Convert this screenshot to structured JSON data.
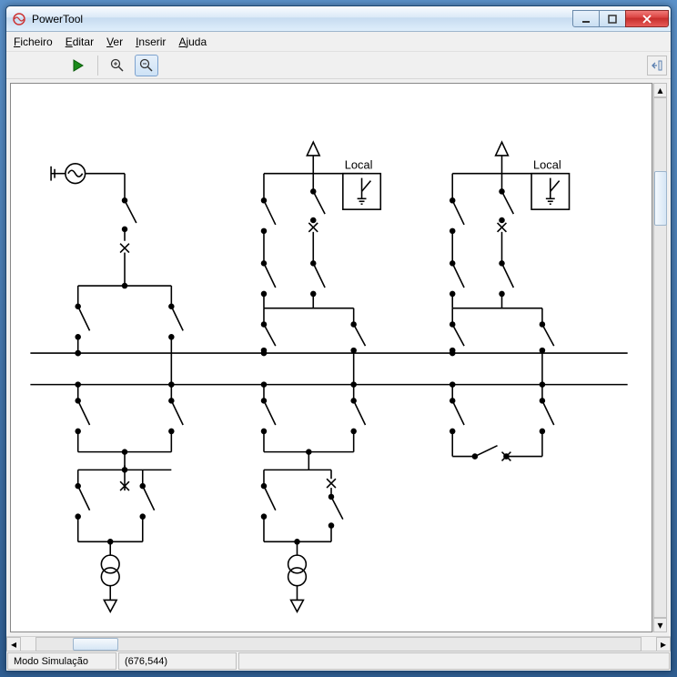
{
  "window": {
    "title": "PowerTool"
  },
  "menubar": {
    "items": [
      {
        "label": "Ficheiro",
        "underline_index": 0
      },
      {
        "label": "Editar",
        "underline_index": 0
      },
      {
        "label": "Ver",
        "underline_index": 0
      },
      {
        "label": "Inserir",
        "underline_index": 0
      },
      {
        "label": "Ajuda",
        "underline_index": 0
      }
    ]
  },
  "toolbar": {
    "run": "Run",
    "zoom_in": "Zoom In",
    "zoom_out": "Zoom Out"
  },
  "canvas": {
    "local_label_1": "Local",
    "local_label_2": "Local"
  },
  "statusbar": {
    "mode": "Modo Simulação",
    "coords": "(676,544)"
  }
}
